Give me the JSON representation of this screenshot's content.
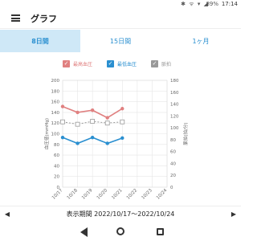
{
  "status_bar": {
    "icons": "✱ ᯤ ▾ ◢",
    "battery": "89%",
    "time": "17:14"
  },
  "app_bar": {
    "title": "グラフ",
    "menu_icon": "hamburger-menu-icon"
  },
  "tabs": [
    {
      "label": "8日間",
      "active": true
    },
    {
      "label": "15日間",
      "active": false
    },
    {
      "label": "1ヶ月",
      "active": false
    }
  ],
  "legend": [
    {
      "label": "最高血圧",
      "color": "#e08080",
      "checked": true
    },
    {
      "label": "最低血圧",
      "color": "#2a8fd0",
      "checked": true
    },
    {
      "label": "脈拍",
      "color": "#999999",
      "checked": true
    }
  ],
  "chart_data": {
    "type": "line",
    "categories": [
      "10/17",
      "10/18",
      "10/19",
      "10/20",
      "10/21",
      "10/22",
      "10/23",
      "10/24"
    ],
    "ylabel": "血圧値(mmHg)",
    "ylabel_right": "脈拍(拍/分)",
    "ylim": [
      0,
      200
    ],
    "ylim_right": [
      0,
      180
    ],
    "yticks": [
      0,
      20,
      40,
      60,
      80,
      100,
      120,
      140,
      160,
      180,
      200
    ],
    "yticks_right": [
      0,
      20,
      40,
      60,
      80,
      100,
      120,
      140,
      160,
      180
    ],
    "grid": true,
    "series": [
      {
        "name": "最高血圧",
        "axis": "left",
        "color": "#e08080",
        "style": "solid",
        "values": [
          151,
          140,
          144,
          130,
          147,
          null,
          null,
          null
        ]
      },
      {
        "name": "最低血圧",
        "axis": "left",
        "color": "#2a8fd0",
        "style": "solid",
        "values": [
          93,
          82,
          93,
          82,
          92,
          null,
          null,
          null
        ]
      },
      {
        "name": "脈拍",
        "axis": "right",
        "color": "#999999",
        "style": "dashed",
        "values": [
          110,
          106,
          111,
          108,
          110,
          null,
          null,
          null
        ]
      }
    ]
  },
  "footer": {
    "prev_arrow": "◀",
    "next_arrow": "▶",
    "range_text": "表示期間 2022/10/17〜2022/10/24"
  }
}
